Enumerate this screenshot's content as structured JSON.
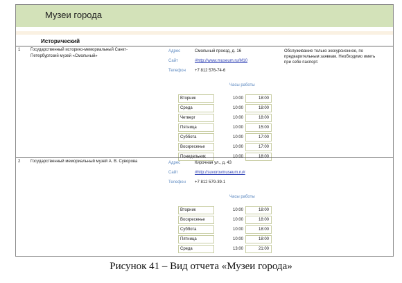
{
  "report": {
    "title": "Музеи города",
    "category": "Исторический",
    "labels": {
      "address": "Адрес",
      "site": "Сайт",
      "phone": "Телефон",
      "hours": "Часы работы"
    },
    "museums": [
      {
        "num": "1",
        "name_lines": [
          "Государственный историко-мемориальный Санкт-",
          "Петербургский музей «Смольный»"
        ],
        "address": "Смольный проезд, д. 16",
        "site": "#http://www.museum.ru/M10",
        "phone": "+7 812 576-74-6",
        "note_lines": [
          "Обслуживание только экскурсионное, по",
          "предварительным заявкам. Необходимо иметь",
          "при себе паспорт."
        ],
        "schedule": [
          {
            "day": "Вторник",
            "from": "10:00",
            "to": "18:00"
          },
          {
            "day": "Среда",
            "from": "10:00",
            "to": "18:00"
          },
          {
            "day": "Четверг",
            "from": "10:00",
            "to": "18:00"
          },
          {
            "day": "Пятница",
            "from": "10:00",
            "to": "15:00"
          },
          {
            "day": "Суббота",
            "from": "10:00",
            "to": "17:00"
          },
          {
            "day": "Воскресенье",
            "from": "10:00",
            "to": "17:00"
          },
          {
            "day": "Понедельник",
            "from": "10:00",
            "to": "18:00"
          }
        ]
      },
      {
        "num": "2",
        "name_lines": [
          "Государственный мемориальный музей А. В. Суворова"
        ],
        "address": "Кирочная ул., д. 43",
        "site": "#http://suvorovmuseum.ru#",
        "phone": "+7 812 579-39-1",
        "note_lines": [],
        "schedule": [
          {
            "day": "Вторник",
            "from": "10:00",
            "to": "18:00"
          },
          {
            "day": "Воскресенье",
            "from": "10:00",
            "to": "18:00"
          },
          {
            "day": "Суббота",
            "from": "10:00",
            "to": "18:00"
          },
          {
            "day": "Пятница",
            "from": "10:00",
            "to": "18:00"
          },
          {
            "day": "Среда",
            "from": "13:00",
            "to": "21:00"
          }
        ]
      }
    ]
  },
  "caption": "Рисунок 41 – Вид отчета «Музеи города»"
}
